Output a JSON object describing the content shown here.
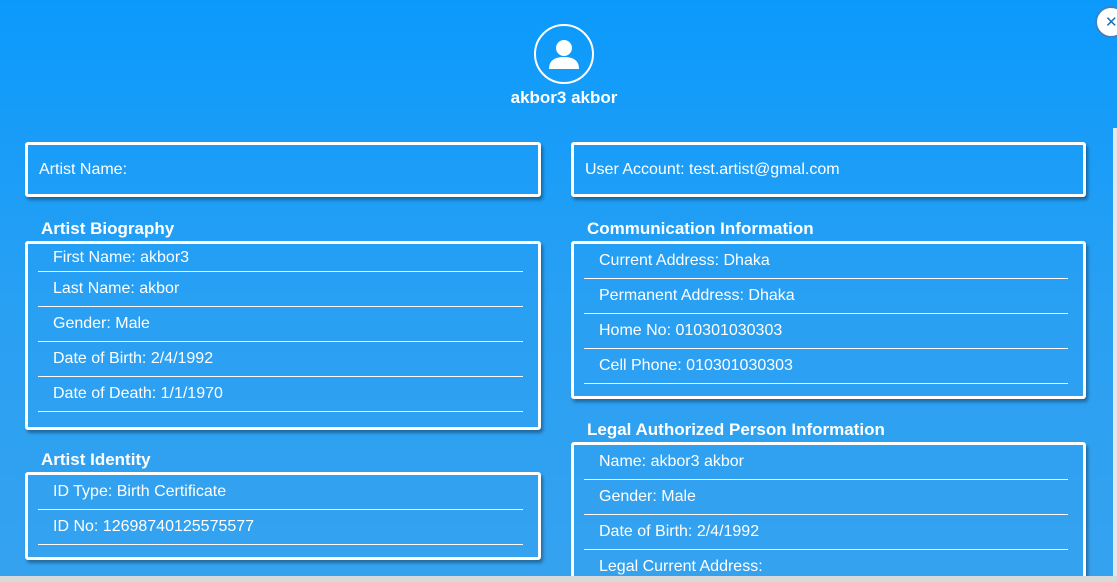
{
  "profile": {
    "name": "akbor3 akbor",
    "avatar_icon": "user-icon",
    "close_icon": "close-icon"
  },
  "artist_name": {
    "label": "Artist Name:"
  },
  "user_account": {
    "label": "User Account: test.artist@gmal.com"
  },
  "biography": {
    "title": "Artist Biography",
    "rows": [
      "First Name: akbor3",
      "Last Name: akbor",
      "Gender: Male",
      "Date of Birth: 2/4/1992",
      "Date of Death: 1/1/1970"
    ]
  },
  "communication": {
    "title": "Communication Information",
    "rows": [
      "Current Address: Dhaka",
      "Permanent Address: Dhaka",
      "Home No: 010301030303",
      "Cell Phone: 010301030303"
    ]
  },
  "identity": {
    "title": "Artist Identity",
    "rows": [
      "ID Type: Birth Certificate",
      "ID No: 12698740125575577"
    ]
  },
  "legal": {
    "title": "Legal Authorized Person Information",
    "rows": [
      "Name: akbor3 akbor",
      "Gender: Male",
      "Date of Birth: 2/4/1992",
      "Legal Current Address:"
    ]
  },
  "colors": {
    "background_top": "#0b9afc",
    "background_bottom": "#35a2ef",
    "text": "#ffffff"
  }
}
